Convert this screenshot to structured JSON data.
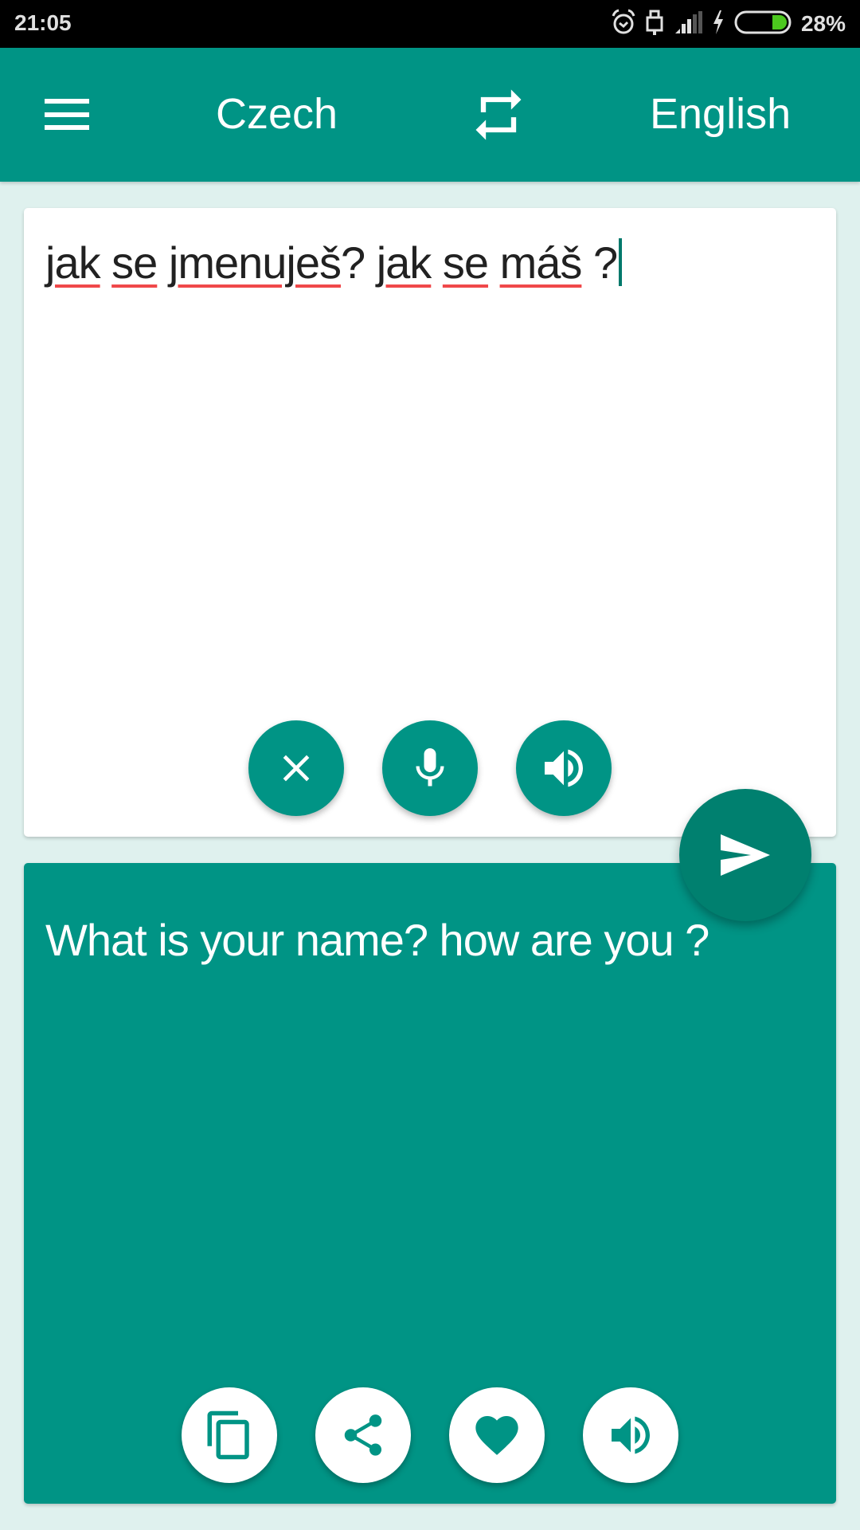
{
  "status_bar": {
    "time": "21:05",
    "battery_percent": "28%",
    "battery_level": 0.28,
    "icons": [
      "alarm-icon",
      "usb-lock-icon",
      "signal-icon",
      "charging-icon",
      "battery-icon"
    ]
  },
  "toolbar": {
    "menu_icon": "hamburger-menu-icon",
    "source_language": "Czech",
    "swap_icon": "swap-languages-icon",
    "target_language": "English"
  },
  "input_card": {
    "text_words": [
      "jak",
      "se",
      "jmenuješ",
      "?",
      "jak",
      "se",
      "máš",
      "?"
    ],
    "text": "jak se jmenuješ? jak se máš ?",
    "buttons": [
      {
        "name": "clear",
        "icon": "close-icon"
      },
      {
        "name": "voice-input",
        "icon": "microphone-icon"
      },
      {
        "name": "speak-source",
        "icon": "speaker-icon"
      }
    ]
  },
  "translate_button": {
    "icon": "send-icon"
  },
  "output_card": {
    "text": "What is your name? how are you ?",
    "buttons": [
      {
        "name": "copy",
        "icon": "copy-icon"
      },
      {
        "name": "share",
        "icon": "share-icon"
      },
      {
        "name": "favorite",
        "icon": "heart-icon"
      },
      {
        "name": "speak-translation",
        "icon": "speaker-icon"
      }
    ]
  },
  "colors": {
    "primary": "#009485",
    "primary_dark": "#00806f",
    "background": "#dff1ee",
    "spellcheck_underline": "#f0484a",
    "battery_fill": "#4cc81e"
  }
}
